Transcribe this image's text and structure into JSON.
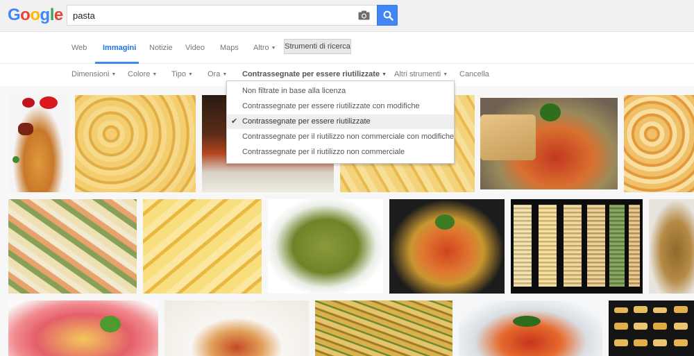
{
  "header": {
    "logo_letters": [
      "G",
      "o",
      "o",
      "g",
      "l",
      "e"
    ],
    "logo_colors": [
      "#4285f4",
      "#ea4335",
      "#fbbc05",
      "#4285f4",
      "#34a853",
      "#ea4335"
    ],
    "search_query": "pasta"
  },
  "tabs": {
    "items": [
      {
        "label": "Web"
      },
      {
        "label": "Immagini"
      },
      {
        "label": "Notizie"
      },
      {
        "label": "Video"
      },
      {
        "label": "Maps"
      },
      {
        "label": "Altro"
      }
    ],
    "tools_label": "Strumenti di ricerca"
  },
  "filters": {
    "items": [
      {
        "label": "Dimensioni"
      },
      {
        "label": "Colore"
      },
      {
        "label": "Tipo"
      },
      {
        "label": "Ora"
      },
      {
        "label": "Contrassegnate per essere riutilizzate"
      },
      {
        "label": "Altri strumenti"
      }
    ],
    "cancel_label": "Cancella"
  },
  "dropdown": {
    "options": [
      {
        "label": "Non filtrate in base alla licenza"
      },
      {
        "label": "Contrassegnate per essere riutilizzate con modifiche"
      },
      {
        "label": "Contrassegnate per essere riutilizzate"
      },
      {
        "label": "Contrassegnate per il riutilizzo non commerciale con modifiche"
      },
      {
        "label": "Contrassegnate per il riutilizzo non commerciale"
      }
    ],
    "selected_index": 2,
    "check_glyph": "✔"
  },
  "colors": {
    "accent": "#4285f4",
    "header_bg": "#f1f1f1"
  }
}
